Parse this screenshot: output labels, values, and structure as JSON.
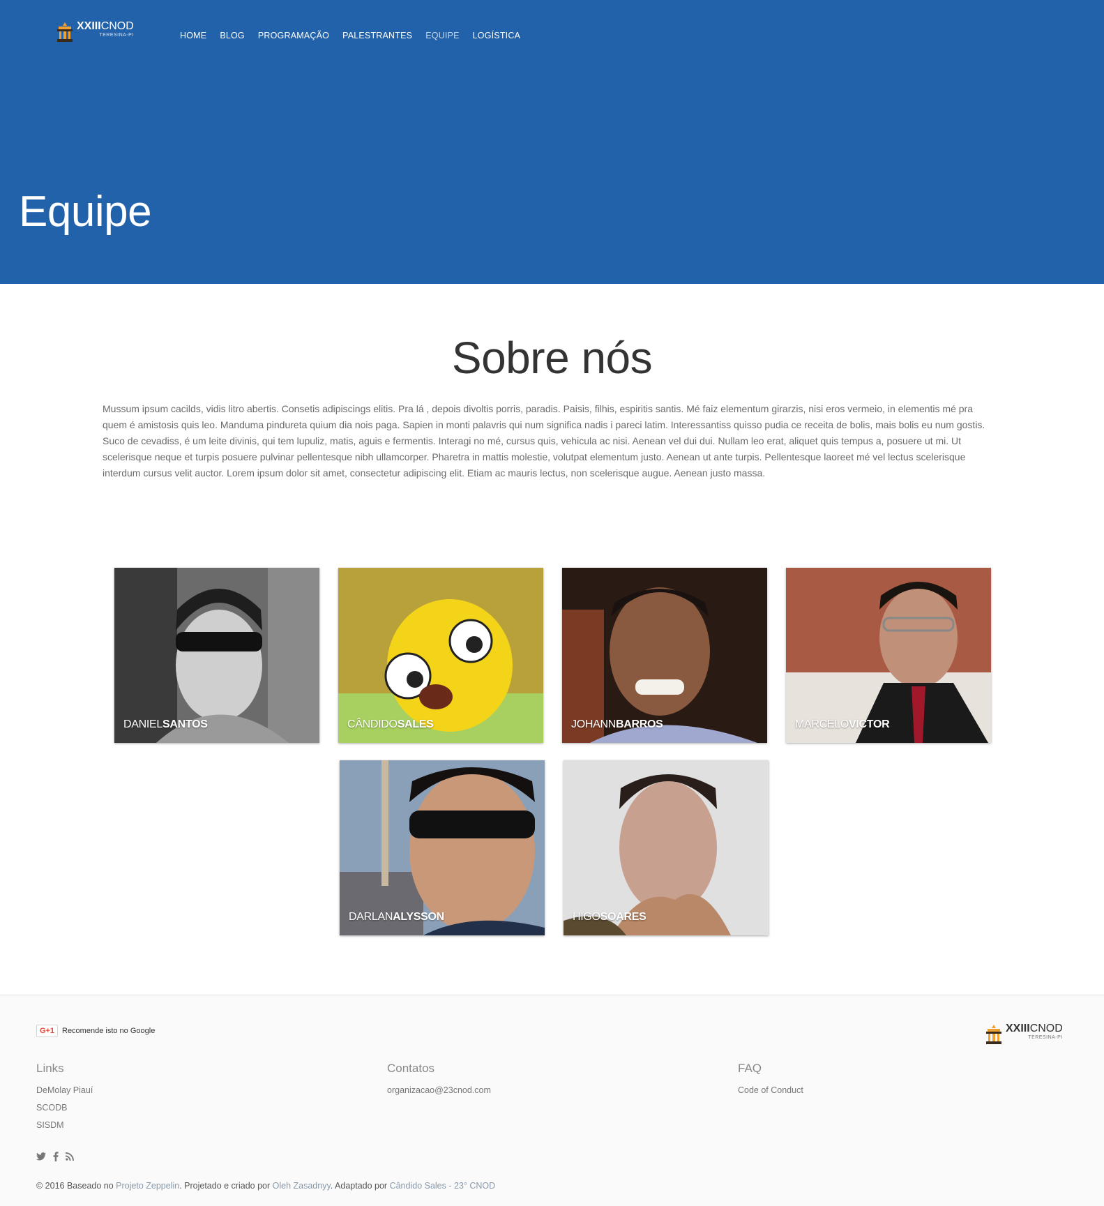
{
  "brand": {
    "name_bold": "XXIII",
    "name_rest": "CNOD",
    "tagline": "TERESINA-PI"
  },
  "nav": {
    "items": [
      "HOME",
      "BLOG",
      "PROGRAMAÇÃO",
      "PALESTRANTES",
      "EQUIPE",
      "LOGÍSTICA"
    ],
    "active": "EQUIPE"
  },
  "hero": {
    "title": "Equipe"
  },
  "about": {
    "title": "Sobre nós",
    "text": "Mussum ipsum cacilds, vidis litro abertis. Consetis adipiscings elitis. Pra lá , depois divoltis porris, paradis. Paisis, filhis, espiritis santis. Mé faiz elementum girarzis, nisi eros vermeio, in elementis mé pra quem é amistosis quis leo. Manduma pindureta quium dia nois paga. Sapien in monti palavris qui num significa nadis i pareci latim. Interessantiss quisso pudia ce receita de bolis, mais bolis eu num gostis. Suco de cevadiss, é um leite divinis, qui tem lupuliz, matis, aguis e fermentis. Interagi no mé, cursus quis, vehicula ac nisi. Aenean vel dui dui. Nullam leo erat, aliquet quis tempus a, posuere ut mi. Ut scelerisque neque et turpis posuere pulvinar pellentesque nibh ullamcorper. Pharetra in mattis molestie, volutpat elementum justo. Aenean ut ante turpis. Pellentesque laoreet mé vel lectus scelerisque interdum cursus velit auctor. Lorem ipsum dolor sit amet, consectetur adipiscing elit. Etiam ac mauris lectus, non scelerisque augue. Aenean justo massa."
  },
  "team": [
    {
      "first": "DANIEL",
      "last": "SANTOS"
    },
    {
      "first": "CÂNDIDO",
      "last": "SALES"
    },
    {
      "first": "JOHANN",
      "last": "BARROS"
    },
    {
      "first": "MARCELO",
      "last": "VICTOR"
    },
    {
      "first": "DARLAN",
      "last": "ALYSSON"
    },
    {
      "first": "HIGO",
      "last": "SOARES"
    }
  ],
  "footer": {
    "gplus_button": "G+1",
    "gplus_text": "Recomende isto no Google",
    "columns": [
      {
        "title": "Links",
        "items": [
          "DeMolay Piauí",
          "SCODB",
          "SISDM"
        ]
      },
      {
        "title": "Contatos",
        "items": [
          "organizacao@23cnod.com"
        ]
      },
      {
        "title": "FAQ",
        "items": [
          "Code of Conduct"
        ]
      }
    ],
    "social_icons": [
      "twitter-icon",
      "facebook-icon",
      "rss-icon"
    ],
    "copyright": {
      "prefix": "© 2016 Baseado no ",
      "link1": "Projeto Zeppelin",
      "middle": ". Projetado e criado por ",
      "link2": "Oleh Zasadnyy",
      "middle2": ". Adaptado por ",
      "link3": "Cândido Sales - 23° CNOD"
    }
  },
  "colors": {
    "hero_bg": "#2262aa",
    "footer_bg": "#fafafa",
    "link": "#8899aa"
  }
}
